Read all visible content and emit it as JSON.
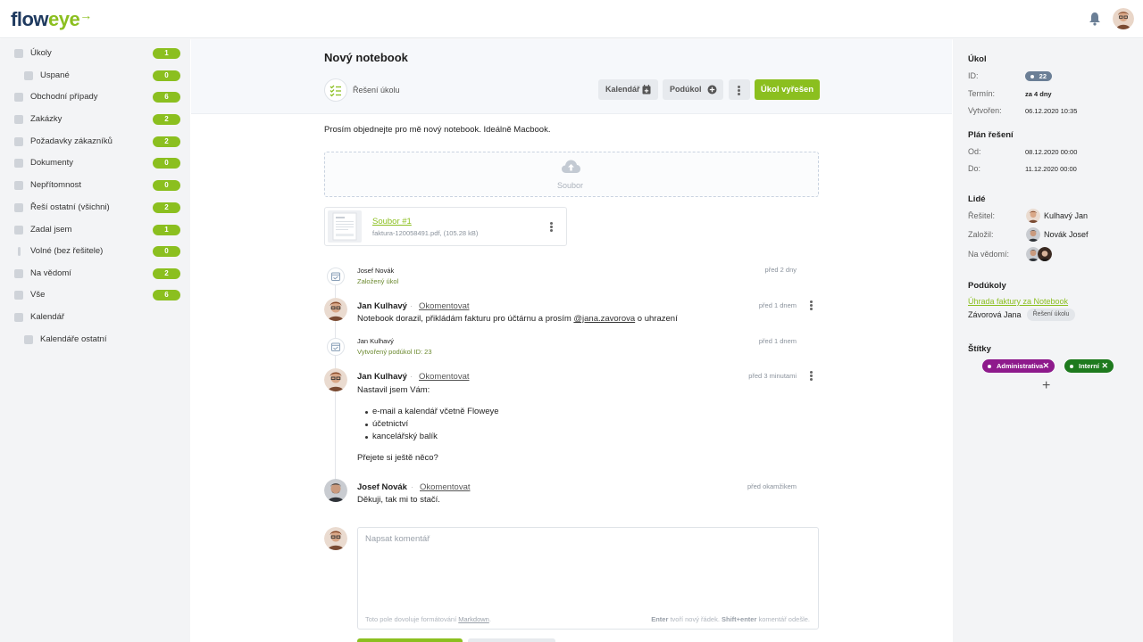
{
  "app": {
    "logo_flow": "flo",
    "logo_o": "w",
    "logo_eye": "eye",
    "logo_arrow": "→"
  },
  "sidebar": {
    "items": [
      {
        "label": "Úkoly",
        "count": "1",
        "icon": "bell-icon"
      },
      {
        "label": "Uspané",
        "count": "0",
        "icon": "sleep-icon"
      },
      {
        "label": "Obchodní případy",
        "count": "6",
        "icon": "briefcase-icon"
      },
      {
        "label": "Zakázky",
        "count": "2",
        "icon": "car-icon"
      },
      {
        "label": "Požadavky zákazníků",
        "count": "2",
        "icon": "chat-icon"
      },
      {
        "label": "Dokumenty",
        "count": "0",
        "icon": "documents-icon"
      },
      {
        "label": "Nepřítomnost",
        "count": "0",
        "icon": "calendar-icon"
      },
      {
        "label": "Řeší ostatní (všichni)",
        "count": "2",
        "icon": "team-icon"
      },
      {
        "label": "Zadal jsem",
        "count": "1",
        "icon": "assign-icon"
      },
      {
        "label": "Volné (bez řešitele)",
        "count": "0",
        "icon": "exclamation-icon"
      },
      {
        "label": "Na vědomí",
        "count": "2",
        "icon": "inbox-icon"
      },
      {
        "label": "Vše",
        "count": "6",
        "icon": "folder-icon"
      },
      {
        "label": "Kalendář",
        "count": "",
        "icon": "calendar-icon"
      },
      {
        "label": "Kalendáře ostatní",
        "count": "",
        "icon": "calendar-icon"
      }
    ]
  },
  "task": {
    "title": "Nový notebook",
    "solve_label": "Řešení úkolu",
    "buttons": {
      "calendar": "Kalendář",
      "subtask": "Podúkol",
      "solved": "Úkol vyřešen"
    },
    "description": "Prosím objednejte pro mě nový notebook. Ideálně Macbook.",
    "dropzone_label": "Soubor",
    "file": {
      "name": "Soubor #1",
      "meta": "faktura-120058491.pdf, (105.28 kB)"
    }
  },
  "timeline": {
    "event1": {
      "name": "Josef Novák",
      "sub": "Založený úkol",
      "time": "před 2 dny"
    },
    "comment1": {
      "name": "Jan Kulhavý",
      "action": "Okomentovat",
      "time": "před 1 dnem",
      "text_before": "Notebook dorazil, přikládám fakturu pro účtárnu a prosím ",
      "mention": "@jana.zavorova",
      "text_after": " o uhrazení"
    },
    "event2": {
      "name": "Jan Kulhavý",
      "sub": "Vytvořený podúkol ID: 23",
      "time": "před 1 dnem"
    },
    "comment2": {
      "name": "Jan Kulhavý",
      "action": "Okomentovat",
      "time": "před 3 minutami",
      "intro": "Nastavil jsem Vám:",
      "items": [
        "e-mail a kalendář včetně Floweye",
        "účetnictví",
        "kancelářský balík"
      ],
      "outro": "Přejete si ještě něco?"
    },
    "comment3": {
      "name": "Josef Novák",
      "action": "Okomentovat",
      "time": "před okamžikem",
      "text": "Děkuji, tak mi to stačí."
    }
  },
  "composer": {
    "placeholder": "Napsat komentář",
    "hint_left_a": "Toto pole dovoluje formátování ",
    "hint_left_link": "Markdown",
    "hint_left_b": ".",
    "hint_right_a": "Enter",
    "hint_right_b": " tvoří nový řádek. ",
    "hint_right_c": "Shift+enter",
    "hint_right_d": " komentář odešle."
  },
  "right": {
    "task_heading": "Úkol",
    "id_label": "ID:",
    "id_value": "22",
    "term_label": "Termín:",
    "term_value": "za 4 dny",
    "created_label": "Vytvořen:",
    "created_value": "06.12.2020 10:35",
    "plan_heading": "Plán řešení",
    "from_label": "Od:",
    "from_value": "08.12.2020 00:00",
    "to_label": "Do:",
    "to_value": "11.12.2020 00:00",
    "people_heading": "Lidé",
    "solver_label": "Řešitel:",
    "solver_name": "Kulhavý Jan",
    "creator_label": "Založil:",
    "creator_name": "Novák Josef",
    "aware_label": "Na vědomí:",
    "subtasks_heading": "Podúkoly",
    "subtask_link": "Úhrada faktury za Notebook",
    "subtask_person": "Závorová Jana",
    "subtask_chip": "Řešení úkolu",
    "tags_heading": "Štítky",
    "tags": [
      {
        "label": "Administrativa",
        "color": "#8e1a8c"
      },
      {
        "label": "Interní",
        "color": "#1e7a1e"
      }
    ],
    "add_tag": "+"
  },
  "colors": {
    "accent": "#8bbf1f",
    "brand_dark": "#1f3a5f",
    "sidebar_bg": "#f3f4f6"
  }
}
